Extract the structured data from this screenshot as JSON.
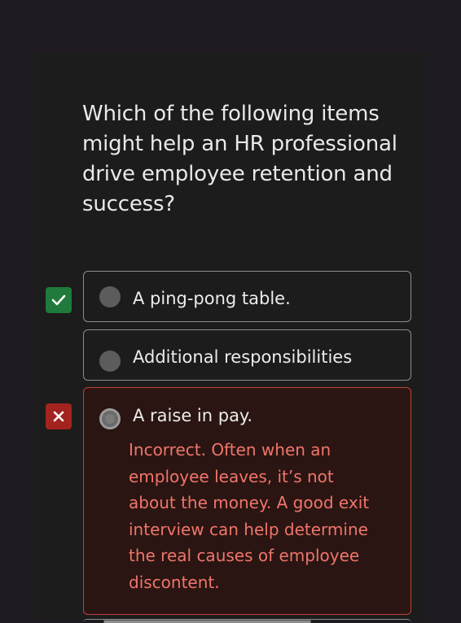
{
  "question": {
    "text": "Which of the following items might help an HR professional drive employee retention and success?"
  },
  "options": [
    {
      "label": "A ping-pong table.",
      "marker": "check-icon",
      "marker_color": "#1f7a3c",
      "selected": false
    },
    {
      "label": "Additional responsibilities",
      "marker": null,
      "selected": false
    },
    {
      "label": "A raise in pay.",
      "marker": "close-icon",
      "marker_color": "#a3231f",
      "selected": true,
      "state": "incorrect",
      "feedback": "Incorrect. Often when an employee leaves, it’s not about the money. A good exit interview can help determine the real causes of employee discontent."
    }
  ],
  "colors": {
    "background": "#201a23",
    "card": "#1c1c1c",
    "feedback_text": "#f0756b",
    "incorrect_border": "#c0413b",
    "correct_badge": "#1f7a3c",
    "wrong_badge": "#a3231f"
  }
}
